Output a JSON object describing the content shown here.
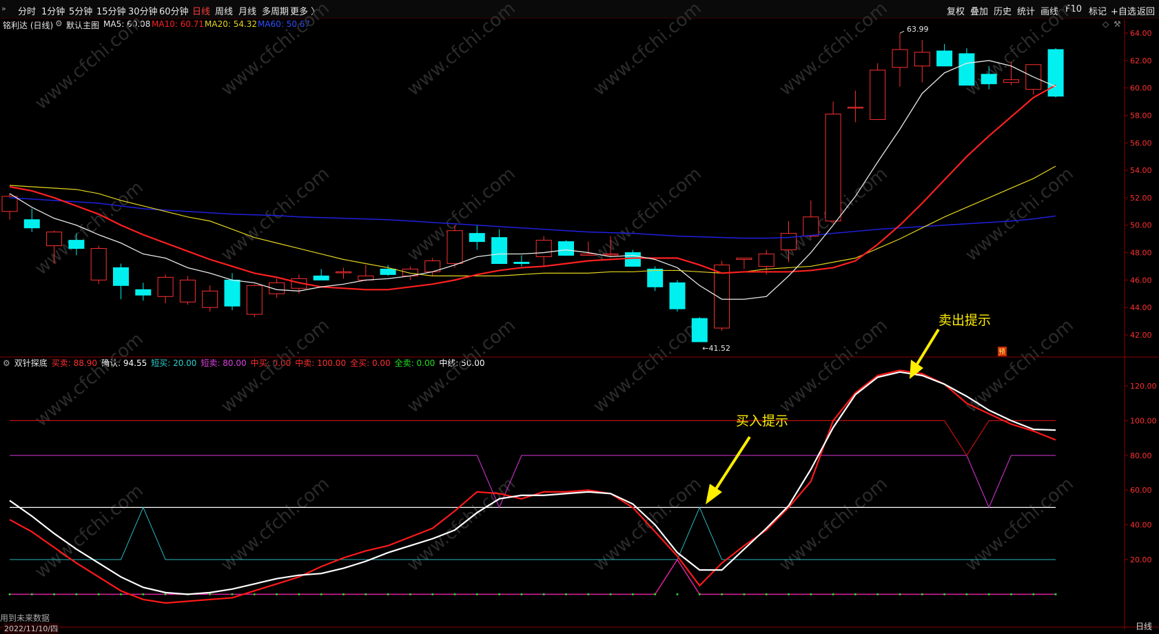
{
  "toolbar": {
    "tabs": [
      "分时",
      "1分钟",
      "5分钟",
      "15分钟",
      "30分钟",
      "60分钟",
      "日线",
      "周线",
      "月线",
      "多周期",
      "更多 〉"
    ],
    "active_tab": "日线",
    "right": [
      "复权",
      "叠加",
      "历史",
      "统计",
      "画线",
      "F10",
      "标记",
      "+自选",
      "返回"
    ]
  },
  "main_header": {
    "stock": "铭利达 (日线)",
    "template": "默认主图",
    "ma5": "MA5: 60.08",
    "ma10": "MA10: 60.71",
    "ma20": "MA20: 54.32",
    "ma60": "MA60: 50.67"
  },
  "indicator_header": {
    "name": "双针探底",
    "items": [
      {
        "text": "买卖: 88.90",
        "color": "#ff3030"
      },
      {
        "text": "确认: 94.55",
        "color": "#ffffff"
      },
      {
        "text": "短买: 20.00",
        "color": "#2ad0d0"
      },
      {
        "text": "短卖: 80.00",
        "color": "#e040e0"
      },
      {
        "text": "中买: 0.00",
        "color": "#ff3030"
      },
      {
        "text": "中卖: 100.00",
        "color": "#ff3030"
      },
      {
        "text": "全买: 0.00",
        "color": "#ff3030"
      },
      {
        "text": "全卖: 0.00",
        "color": "#20e020"
      },
      {
        "text": "中线: 50.00",
        "color": "#ffffff"
      }
    ]
  },
  "price_axis": [
    "64.00",
    "62.00",
    "60.00",
    "58.00",
    "56.00",
    "54.00",
    "52.00",
    "50.00",
    "48.00",
    "46.00",
    "44.00",
    "42.00"
  ],
  "ind_axis": [
    "120.00",
    "100.00",
    "80.00",
    "60.00",
    "40.00",
    "20.00"
  ],
  "annotations": {
    "high": "63.99",
    "low": "41.52",
    "buy_hint": "买入提示",
    "sell_hint": "卖出提示",
    "badge": "预"
  },
  "bottom": {
    "note": "用到未来数据",
    "date": "2022/11/10/四",
    "axis_end": "日线"
  },
  "watermark": "www.cfchi.com",
  "colors": {
    "up": "#ff3030",
    "down": "#00f0f0",
    "ma5": "#e8e8e8",
    "ma10": "#ff2020",
    "ma20": "#e6d51e",
    "ma60": "#2020e0",
    "annotation": "#ffee00"
  },
  "chart_data": {
    "type": "candlestick",
    "candles": [
      [
        51.0,
        52.3,
        50.4,
        52.1
      ],
      [
        50.4,
        51.2,
        49.5,
        49.8
      ],
      [
        48.5,
        49.6,
        47.2,
        49.5
      ],
      [
        48.9,
        49.4,
        47.8,
        48.3
      ],
      [
        46.0,
        48.5,
        45.7,
        48.3
      ],
      [
        46.9,
        47.2,
        44.6,
        45.6
      ],
      [
        45.3,
        45.8,
        44.5,
        44.9
      ],
      [
        44.8,
        46.4,
        44.3,
        46.2
      ],
      [
        44.4,
        46.3,
        44.2,
        46.0
      ],
      [
        44.0,
        45.6,
        43.7,
        45.2
      ],
      [
        46.0,
        46.5,
        43.8,
        44.1
      ],
      [
        43.5,
        45.7,
        43.3,
        45.6
      ],
      [
        45.0,
        46.1,
        44.7,
        45.8
      ],
      [
        45.4,
        46.4,
        45.0,
        46.1
      ],
      [
        46.3,
        46.8,
        46.0,
        46.0
      ],
      [
        46.6,
        46.9,
        46.1,
        46.6
      ],
      [
        46.0,
        47.1,
        45.9,
        46.3
      ],
      [
        46.8,
        47.1,
        46.3,
        46.4
      ],
      [
        46.3,
        47.0,
        46.0,
        46.8
      ],
      [
        46.6,
        47.6,
        46.3,
        47.4
      ],
      [
        47.2,
        50.0,
        46.9,
        49.6
      ],
      [
        49.4,
        50.0,
        48.2,
        48.8
      ],
      [
        49.1,
        49.7,
        47.2,
        47.2
      ],
      [
        47.3,
        47.8,
        47.0,
        47.2
      ],
      [
        47.7,
        49.2,
        47.0,
        48.9
      ],
      [
        48.8,
        48.9,
        47.8,
        47.8
      ],
      [
        47.8,
        48.8,
        47.8,
        47.9
      ],
      [
        47.9,
        49.2,
        47.7,
        47.9
      ],
      [
        48.0,
        48.2,
        47.8,
        47.0
      ],
      [
        46.8,
        47.0,
        45.2,
        45.5
      ],
      [
        45.8,
        46.0,
        43.7,
        43.9
      ],
      [
        43.2,
        43.3,
        41.5,
        41.5
      ],
      [
        42.5,
        47.4,
        42.3,
        47.1
      ],
      [
        47.5,
        47.6,
        46.8,
        47.6
      ],
      [
        47.0,
        48.2,
        46.4,
        47.9
      ],
      [
        48.2,
        50.3,
        47.3,
        49.4
      ],
      [
        49.2,
        51.8,
        49.1,
        50.6
      ],
      [
        50.3,
        59.0,
        50.1,
        58.1
      ],
      [
        58.6,
        59.8,
        57.5,
        58.6
      ],
      [
        57.7,
        61.8,
        57.8,
        61.3
      ],
      [
        61.5,
        63.99,
        60.1,
        62.8
      ],
      [
        61.6,
        63.5,
        60.4,
        62.6
      ],
      [
        62.7,
        63.2,
        62.2,
        61.6
      ],
      [
        62.5,
        62.9,
        60.5,
        60.2
      ],
      [
        61.0,
        61.6,
        59.9,
        60.3
      ],
      [
        60.4,
        61.9,
        60.2,
        60.6
      ],
      [
        59.9,
        61.4,
        59.5,
        61.7
      ],
      [
        62.8,
        62.9,
        59.3,
        59.4
      ]
    ],
    "ma5": [
      52.3,
      51.3,
      50.5,
      50.0,
      49.3,
      48.7,
      47.9,
      47.6,
      46.9,
      46.5,
      46.0,
      45.8,
      45.3,
      45.2,
      45.5,
      45.7,
      46.0,
      46.1,
      46.3,
      46.6,
      47.1,
      47.7,
      47.9,
      47.9,
      48.0,
      48.2,
      48.0,
      47.7,
      47.8,
      47.5,
      46.9,
      45.6,
      44.6,
      44.6,
      44.8,
      46.3,
      48.0,
      50.0,
      52.1,
      54.6,
      57.0,
      59.6,
      61.1,
      61.8,
      62.0,
      61.6,
      60.8,
      60.1
    ],
    "ma10": [
      52.8,
      52.5,
      52.0,
      51.4,
      50.8,
      50.0,
      49.3,
      48.7,
      48.1,
      47.5,
      47.0,
      46.5,
      46.2,
      45.8,
      45.5,
      45.4,
      45.3,
      45.3,
      45.5,
      45.7,
      46.0,
      46.4,
      46.7,
      46.9,
      47.0,
      47.2,
      47.4,
      47.5,
      47.6,
      47.6,
      47.6,
      47.1,
      46.5,
      46.6,
      46.6,
      46.6,
      46.7,
      46.9,
      47.4,
      48.6,
      50.0,
      51.6,
      53.3,
      55.0,
      56.5,
      57.9,
      59.3,
      60.2
    ],
    "ma20": [
      52.9,
      52.8,
      52.7,
      52.6,
      52.3,
      51.8,
      51.4,
      51.0,
      50.6,
      50.3,
      49.7,
      49.1,
      48.7,
      48.3,
      47.9,
      47.5,
      47.2,
      46.9,
      46.5,
      46.3,
      46.3,
      46.3,
      46.3,
      46.4,
      46.5,
      46.5,
      46.5,
      46.6,
      46.6,
      46.7,
      46.7,
      46.6,
      46.5,
      46.6,
      46.8,
      46.9,
      47.0,
      47.3,
      47.6,
      48.3,
      49.0,
      49.8,
      50.6,
      51.3,
      52.0,
      52.7,
      53.4,
      54.3
    ],
    "ma60": [
      52.0,
      51.9,
      51.8,
      51.7,
      51.6,
      51.4,
      51.2,
      51.1,
      51.0,
      50.9,
      50.8,
      50.75,
      50.7,
      50.6,
      50.55,
      50.5,
      50.45,
      50.4,
      50.3,
      50.2,
      50.1,
      50.0,
      49.9,
      49.8,
      49.7,
      49.6,
      49.5,
      49.45,
      49.4,
      49.3,
      49.2,
      49.15,
      49.1,
      49.05,
      49.05,
      49.1,
      49.25,
      49.4,
      49.55,
      49.7,
      49.8,
      49.9,
      50.0,
      50.1,
      50.2,
      50.3,
      50.45,
      50.67
    ],
    "ind_buysell": [
      43,
      36,
      27,
      18,
      10,
      2,
      -3,
      -5,
      -4,
      -3,
      -2,
      2,
      6,
      10,
      16,
      21,
      25,
      28,
      33,
      38,
      48,
      59,
      58,
      55,
      59,
      59,
      60,
      58,
      50,
      36,
      22,
      5,
      18,
      28,
      37,
      50,
      65,
      100,
      116,
      126,
      129,
      127,
      121,
      110,
      104,
      98,
      94,
      88.9
    ],
    "ind_confirm": [
      54,
      45,
      35,
      26,
      18,
      10,
      4,
      1,
      0,
      1,
      3,
      6,
      9,
      11,
      12,
      15,
      19,
      24,
      28,
      32,
      37,
      47,
      55,
      57,
      57,
      58,
      59,
      58,
      52,
      40,
      24,
      14,
      14,
      26,
      38,
      51,
      72,
      96,
      115,
      125,
      128,
      126,
      121,
      114,
      106,
      100,
      95,
      94.55
    ],
    "ind_short_buy": [
      20,
      20,
      20,
      20,
      20,
      20,
      50,
      20,
      20,
      20,
      20,
      20,
      20,
      20,
      20,
      20,
      20,
      20,
      20,
      20,
      20,
      20,
      20,
      20,
      20,
      20,
      20,
      20,
      20,
      20,
      20,
      50,
      20,
      20,
      20,
      20,
      20,
      20,
      20,
      20,
      20,
      20,
      20,
      20,
      20,
      20,
      20,
      20
    ],
    "ind_short_sell": [
      80,
      80,
      80,
      80,
      80,
      80,
      80,
      80,
      80,
      80,
      80,
      80,
      80,
      80,
      80,
      80,
      80,
      80,
      80,
      80,
      80,
      80,
      50,
      80,
      80,
      80,
      80,
      80,
      80,
      80,
      80,
      80,
      80,
      80,
      80,
      80,
      80,
      80,
      80,
      80,
      80,
      80,
      80,
      80,
      50,
      80,
      80,
      80
    ],
    "ind_mid_sell": [
      100,
      100,
      100,
      100,
      100,
      100,
      100,
      100,
      100,
      100,
      100,
      100,
      100,
      100,
      100,
      100,
      100,
      100,
      100,
      100,
      100,
      100,
      100,
      100,
      100,
      100,
      100,
      100,
      100,
      100,
      100,
      100,
      100,
      100,
      100,
      100,
      100,
      100,
      100,
      100,
      100,
      100,
      100,
      80,
      100,
      100,
      100,
      100
    ],
    "ind_full_buy": [
      0,
      0,
      0,
      0,
      0,
      0,
      0,
      0,
      0,
      0,
      0,
      0,
      0,
      0,
      0,
      0,
      0,
      0,
      0,
      0,
      0,
      0,
      0,
      0,
      0,
      0,
      0,
      0,
      0,
      0,
      20,
      0,
      0,
      0,
      0,
      0,
      0,
      0,
      0,
      0,
      0,
      0,
      0,
      0,
      0,
      0,
      0,
      0
    ],
    "ind_mid_line": 50,
    "price_range": [
      41,
      65
    ],
    "ind_range": [
      -15,
      135
    ]
  }
}
